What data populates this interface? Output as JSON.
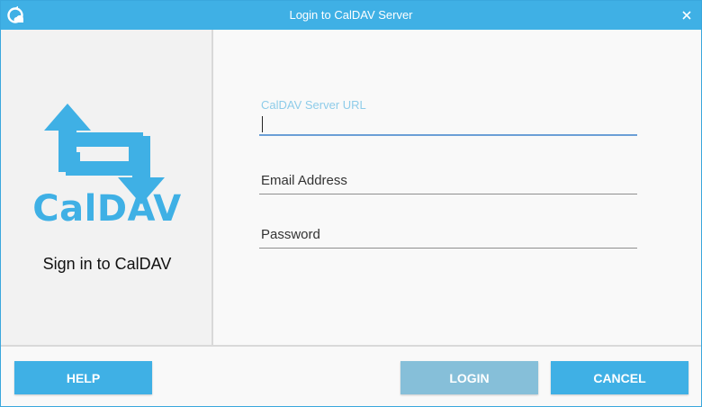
{
  "window": {
    "title": "Login to CalDAV Server",
    "accent_color": "#3fb0e5",
    "app_icon": "sync-cloud-icon",
    "close_icon": "close-icon"
  },
  "left_panel": {
    "logo_text": "CalDAV",
    "logo_icon": "sync-arrows-icon",
    "sign_in_text": "Sign in to CalDAV"
  },
  "form": {
    "server_url": {
      "label": "CalDAV Server URL",
      "value": ""
    },
    "email": {
      "placeholder": "Email Address",
      "value": ""
    },
    "password": {
      "placeholder": "Password",
      "value": ""
    }
  },
  "buttons": {
    "help": "HELP",
    "login": "LOGIN",
    "cancel": "CANCEL",
    "login_disabled_color": "#86bfd9"
  }
}
